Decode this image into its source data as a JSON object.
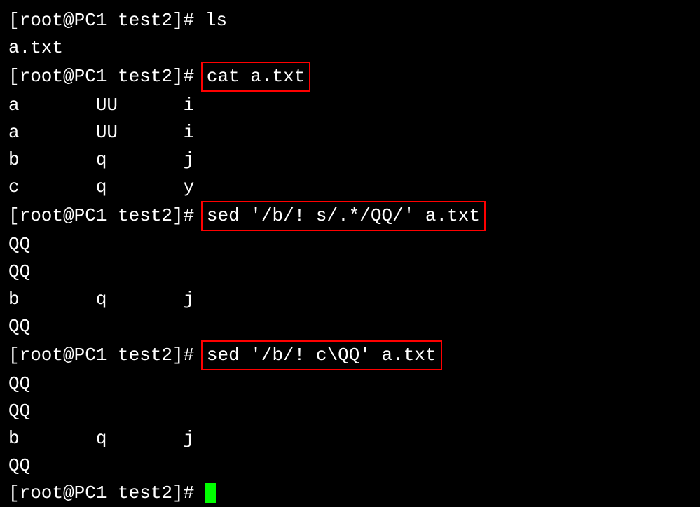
{
  "lines": {
    "prompt1": "[root@PC1 test2]# ",
    "cmd1": "ls",
    "out1": "a.txt",
    "prompt2": "[root@PC1 test2]# ",
    "cmd2_boxed": "cat a.txt",
    "out2_1": "a       UU      i",
    "out2_2": "a       UU      i",
    "out2_3": "b       q       j",
    "out2_4": "c       q       y",
    "prompt3": "[root@PC1 test2]# ",
    "cmd3_boxed": "sed '/b/! s/.*/QQ/' a.txt",
    "out3_1": "QQ",
    "out3_2": "QQ",
    "out3_3": "b       q       j",
    "out3_4": "QQ",
    "prompt4": "[root@PC1 test2]# ",
    "cmd4_boxed": "sed '/b/! c\\QQ' a.txt",
    "out4_1": "QQ",
    "out4_2": "QQ",
    "out4_3": "b       q       j",
    "out4_4": "QQ",
    "prompt5": "[root@PC1 test2]# "
  }
}
